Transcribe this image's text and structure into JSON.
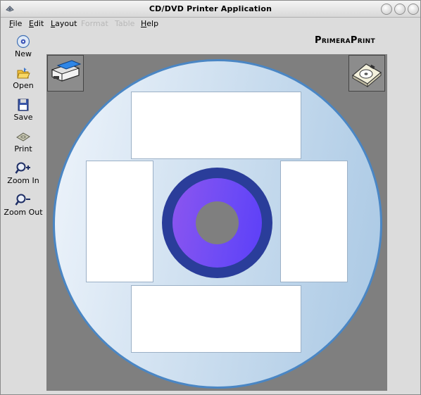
{
  "window": {
    "title": "CD/DVD Printer Application"
  },
  "menu": [
    {
      "label": "File",
      "accel": "F",
      "enabled": true
    },
    {
      "label": "Edit",
      "accel": "E",
      "enabled": true
    },
    {
      "label": "Layout",
      "accel": "L",
      "enabled": true
    },
    {
      "label": "Format",
      "accel": "",
      "enabled": false
    },
    {
      "label": "Table",
      "accel": "",
      "enabled": false
    },
    {
      "label": "Help",
      "accel": "H",
      "enabled": true
    }
  ],
  "brand": "PrimeraPrint",
  "toolbar": [
    {
      "label": "New",
      "icon": "new-disc-icon"
    },
    {
      "label": "Open",
      "icon": "folder-icon"
    },
    {
      "label": "Save",
      "icon": "floppy-disk-icon"
    },
    {
      "label": "Print",
      "icon": "printer-icon"
    },
    {
      "label": "Zoom In",
      "icon": "zoom-in-icon"
    },
    {
      "label": "Zoom Out",
      "icon": "zoom-out-icon"
    }
  ],
  "canvas": {
    "left_button_icon": "disc-printer-icon",
    "right_button_icon": "disc-tray-icon",
    "colors": {
      "background": "#7f7f7f",
      "disc_edge": "#4a86c4",
      "hub_outer": "#2a3d9a",
      "hub_ring": "#6f4cf5"
    }
  }
}
